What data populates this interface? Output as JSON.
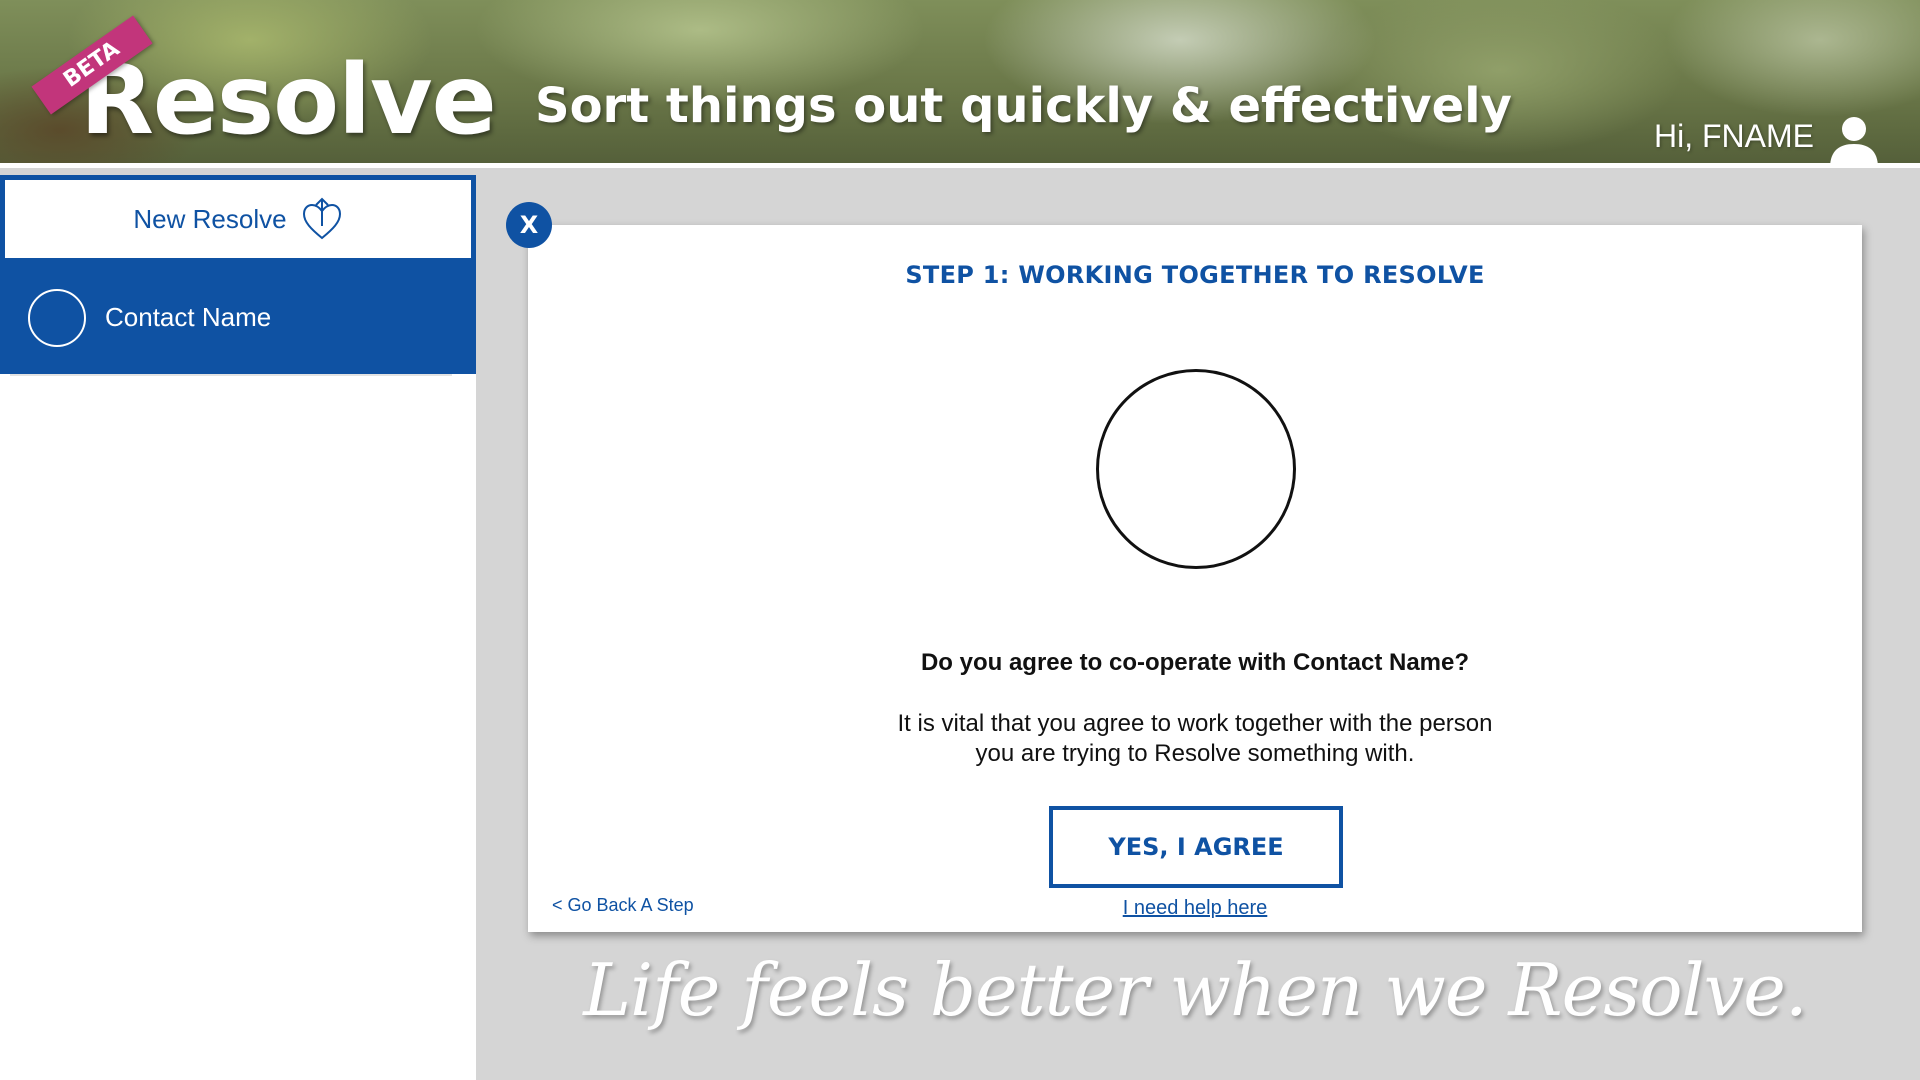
{
  "header": {
    "logo_text": "Resolve",
    "beta_label": "BETA",
    "tagline": "Sort things out quickly & effectively",
    "greeting": "Hi, FNAME",
    "user_icon": "user-icon"
  },
  "sidebar": {
    "new_resolve_label": "New Resolve",
    "new_resolve_icon": "heart-arrow-icon",
    "contacts": [
      {
        "name": "Contact Name"
      }
    ]
  },
  "card": {
    "close_label": "X",
    "step_title": "STEP 1: WORKING TOGETHER TO RESOLVE",
    "question": "Do you agree to co-operate with Contact Name?",
    "description": "It is vital that you agree to work together with the person you are trying to Resolve something with.",
    "agree_button": "YES, I AGREE",
    "help_link": "I need help here",
    "back_link": "< Go Back A Step"
  },
  "footer": {
    "slogan": "Life feels better when we Resolve."
  },
  "colors": {
    "brand_blue": "#0f52a3",
    "beta_pink": "#c2357b",
    "background_gray": "#d5d5d5"
  }
}
